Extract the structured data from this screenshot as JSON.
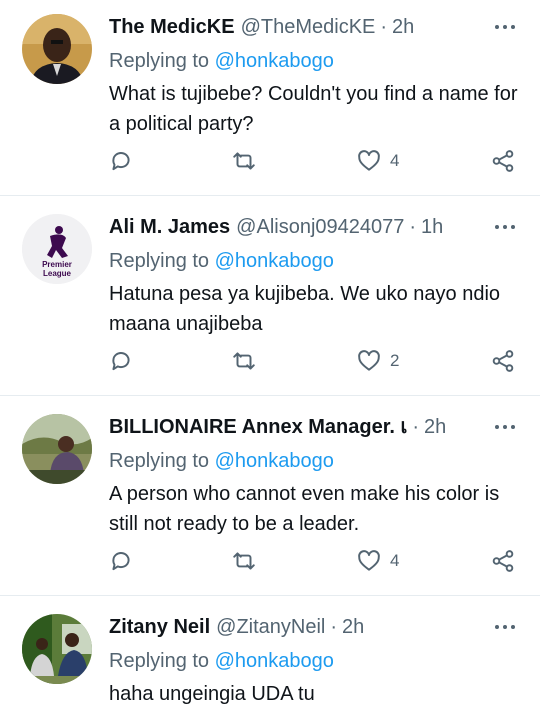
{
  "tweets": [
    {
      "name": "The MedicKE",
      "handle": "@TheMedicKE",
      "time": "2h",
      "replying_label": "Replying to",
      "replying_handle": "@honkabogo",
      "text": "What is tujibebe? Couldn't you find a name for a political party?",
      "likes": "4",
      "avatar": "person-avatar"
    },
    {
      "name": "Ali M. James",
      "handle": "@Alisonj09424077",
      "time": "1h",
      "replying_label": "Replying to",
      "replying_handle": "@honkabogo",
      "text": "Hatuna pesa ya kujibeba. We uko nayo ndio maana unajibeba",
      "likes": "2",
      "avatar": "premier-league-logo",
      "avatar_text": "Premier League"
    },
    {
      "name": "BILLIONAIRE Annex Manager. เ",
      "handle": "",
      "time": "2h",
      "replying_label": "Replying to",
      "replying_handle": "@honkabogo",
      "text": "A person who cannot even make his color is still not ready to be a leader.",
      "likes": "4",
      "avatar": "outdoor-photo-avatar"
    },
    {
      "name": "Zitany Neil",
      "handle": "@ZitanyNeil",
      "time": "2h",
      "replying_label": "Replying to",
      "replying_handle": "@honkabogo",
      "text": "haha ungeingia UDA tu",
      "likes": "",
      "avatar": "group-photo-avatar"
    }
  ],
  "colors": {
    "link": "#1d9bf0",
    "muted": "#536471",
    "text": "#0f1419",
    "divider": "#e6ecf0"
  },
  "separator": "·"
}
